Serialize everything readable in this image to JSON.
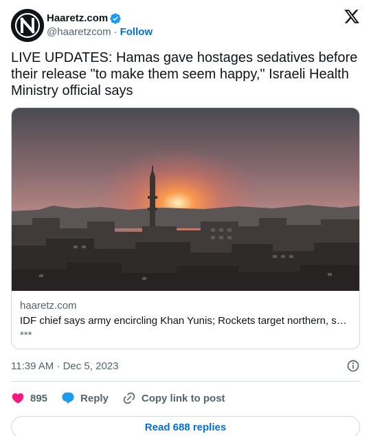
{
  "account": {
    "display_name": "Haaretz.com",
    "handle": "@haaretzcom",
    "separator": "·",
    "follow_label": "Follow",
    "verified_color": "#1d9bf0"
  },
  "tweet": {
    "text": "LIVE UPDATES: Hamas gave hostages sedatives before their release \"to make them seem happy,\" Israeli Health Ministry official says"
  },
  "link_card": {
    "domain": "haaretz.com",
    "title": "IDF chief says army encircling Khan Yunis; Rockets target northern, so…",
    "description": "***"
  },
  "meta": {
    "timestamp": "11:39 AM · Dec 5, 2023"
  },
  "actions": {
    "like_count": "895",
    "reply_label": "Reply",
    "copy_link_label": "Copy link to post",
    "like_color": "#f91880",
    "reply_color": "#1d9bf0"
  },
  "footer": {
    "read_replies_label": "Read 688 replies"
  },
  "icons": [
    "haaretz-logo-icon",
    "verified-badge-icon",
    "x-logo-icon",
    "info-icon",
    "heart-icon",
    "reply-bubble-icon",
    "link-icon"
  ]
}
